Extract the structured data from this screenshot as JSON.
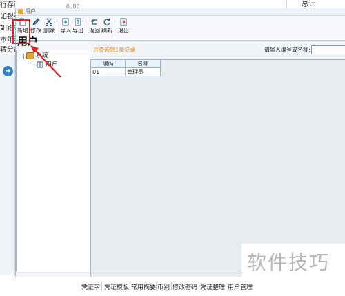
{
  "background": {
    "left_text": [
      "行存款",
      "如银行",
      "如银行",
      "本年利",
      "转分配"
    ],
    "top_value": "0.00",
    "total_label": "总计",
    "bottom_nav": [
      "凭证字",
      "凭证模板",
      "常用摘要",
      "币别",
      "修改密码",
      "凭证整理",
      "用户管理"
    ]
  },
  "dialog": {
    "title": "用户"
  },
  "toolbar": {
    "buttons": [
      {
        "label": "新增",
        "icon": "new-document-icon"
      },
      {
        "label": "修改",
        "icon": "edit-pencil-icon"
      },
      {
        "label": "删除",
        "icon": "delete-scissors-icon"
      },
      {
        "label": "导入",
        "icon": "import-icon"
      },
      {
        "label": "导出",
        "icon": "export-icon"
      },
      {
        "label": "返回",
        "icon": "return-icon"
      },
      {
        "label": "刷新",
        "icon": "refresh-icon"
      },
      {
        "label": "退出",
        "icon": "exit-icon"
      }
    ]
  },
  "left": {
    "heading": "用户",
    "tree": {
      "root": "系统",
      "child": "用户"
    }
  },
  "right": {
    "notice": "共查询到1条记录",
    "search_label": "请输入编号或名称:",
    "search_value": ""
  },
  "grid": {
    "columns": [
      "编码",
      "名称"
    ],
    "rows": [
      [
        "01",
        "管理员"
      ]
    ]
  },
  "watermark": "软件技巧",
  "colors": {
    "highlight": "#e02020",
    "notice": "#e08a1e",
    "grid_header": "#e6f3fb",
    "nav_arrow": "#2f7fc4"
  }
}
